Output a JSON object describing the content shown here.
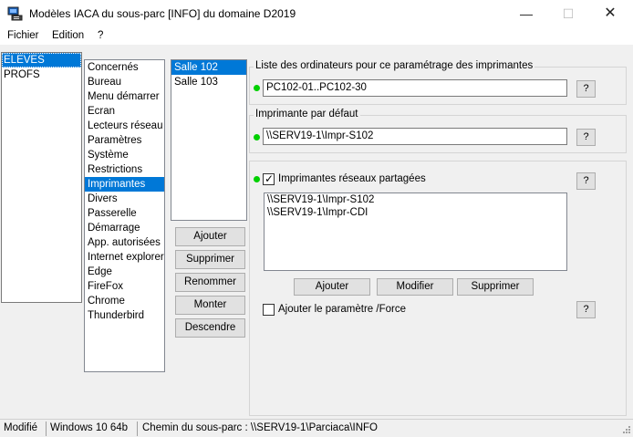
{
  "window": {
    "title": "Modèles IACA du sous-parc [INFO] du domaine D2019",
    "minimize": "—",
    "maximize": "☐",
    "close": "✕"
  },
  "menu": [
    "Fichier",
    "Edition",
    "?"
  ],
  "groups_list": [
    {
      "label": "ELEVES",
      "selected": true
    },
    {
      "label": "PROFS",
      "selected": false
    }
  ],
  "categories_list": [
    {
      "label": "Concernés",
      "selected": false
    },
    {
      "label": "Bureau",
      "selected": false
    },
    {
      "label": "Menu démarrer",
      "selected": false
    },
    {
      "label": "Ecran",
      "selected": false
    },
    {
      "label": "Lecteurs réseau",
      "selected": false
    },
    {
      "label": "Paramètres",
      "selected": false
    },
    {
      "label": "Système",
      "selected": false
    },
    {
      "label": "Restrictions",
      "selected": false
    },
    {
      "label": "Imprimantes",
      "selected": true
    },
    {
      "label": "Divers",
      "selected": false
    },
    {
      "label": "Passerelle",
      "selected": false
    },
    {
      "label": "Démarrage",
      "selected": false
    },
    {
      "label": "App. autorisées",
      "selected": false
    },
    {
      "label": "Internet explorer",
      "selected": false
    },
    {
      "label": "Edge",
      "selected": false
    },
    {
      "label": "FireFox",
      "selected": false
    },
    {
      "label": "Chrome",
      "selected": false
    },
    {
      "label": "Thunderbird",
      "selected": false
    }
  ],
  "rooms_list": [
    {
      "label": "Salle 102",
      "selected": true
    },
    {
      "label": "Salle 103",
      "selected": false
    }
  ],
  "room_buttons": {
    "add": "Ajouter",
    "delete": "Supprimer",
    "rename": "Renommer",
    "up": "Monter",
    "down": "Descendre"
  },
  "computers_section": {
    "title": "Liste des ordinateurs pour ce paramétrage des imprimantes",
    "value": "PC102-01..PC102-30",
    "help": "?"
  },
  "default_printer_section": {
    "title": "Imprimante par défaut",
    "value": "\\\\SERV19-1\\Impr-S102",
    "help": "?"
  },
  "shared_printers_section": {
    "checkbox_label": "Imprimantes réseaux partagées",
    "checked": true,
    "help": "?",
    "printers": [
      "\\\\SERV19-1\\Impr-S102",
      "\\\\SERV19-1\\Impr-CDI"
    ],
    "add": "Ajouter",
    "modify": "Modifier",
    "delete": "Supprimer"
  },
  "force_option": {
    "label": "Ajouter le paramètre /Force",
    "checked": false,
    "help": "?"
  },
  "status_bar": {
    "state": "Modifié",
    "os": "Windows 10 64b",
    "path": "Chemin du sous-parc : \\\\SERV19-1\\Parciaca\\INFO"
  },
  "colors": {
    "selection": "#0078d7",
    "status_dot": "#00d000"
  }
}
